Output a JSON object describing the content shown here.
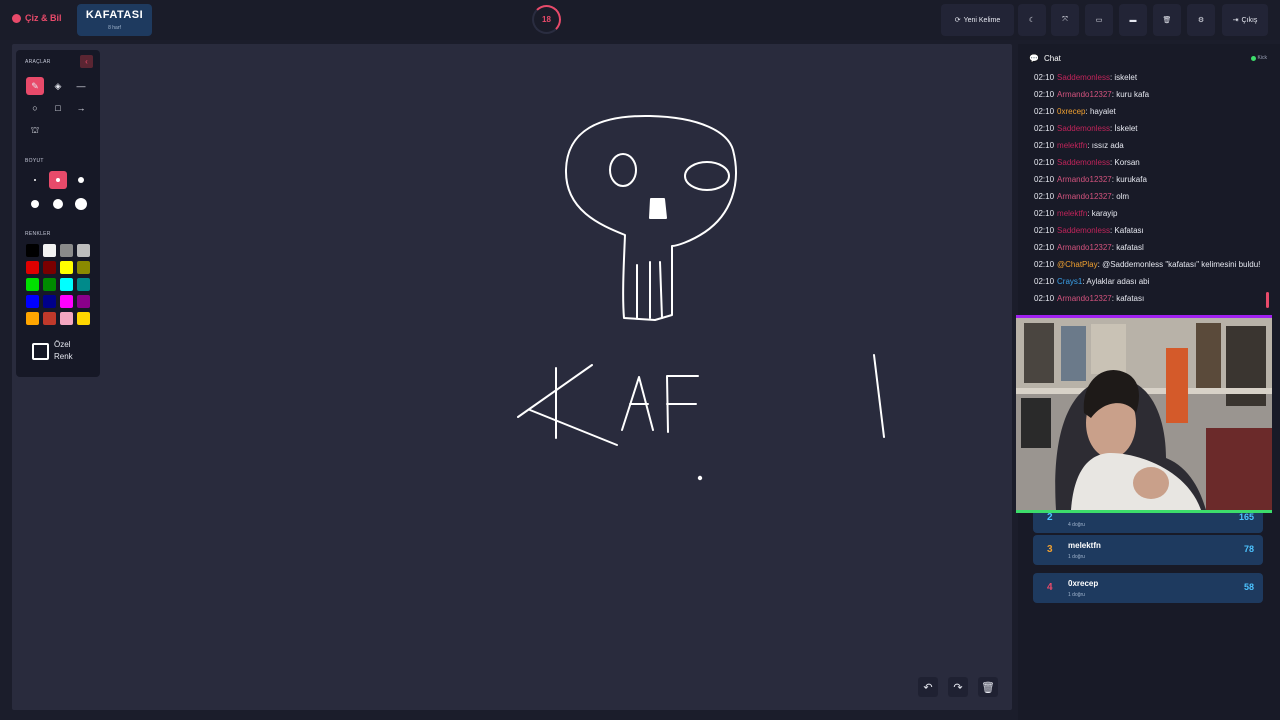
{
  "brand": {
    "name": "Çiz & Bil"
  },
  "word": {
    "text": "KAFATASI",
    "hint": "8 harf"
  },
  "timer": {
    "value": "18"
  },
  "toolbar": {
    "new_word": "Yeni Kelime",
    "exit": "Çıkış"
  },
  "tools": {
    "section_tools": "ARAÇLAR",
    "section_size": "BOYUT",
    "section_colors": "RENKLER",
    "custom_color": "Özel Renk",
    "selected_tool": "pencil",
    "selected_size_index": 1,
    "palette": [
      "#000000",
      "#f2f2f2",
      "#8a8a8a",
      "#bdbdbd",
      "#e00000",
      "#7a0000",
      "#ffff00",
      "#8a8a00",
      "#00e000",
      "#008a00",
      "#00ffff",
      "#008a8a",
      "#0000ff",
      "#00008a",
      "#ff00ff",
      "#8a008a",
      "#ffa500",
      "#c0392b",
      "#f4a6c0",
      "#ffd700"
    ]
  },
  "chat": {
    "title": "Chat",
    "source": "Kick",
    "messages": [
      {
        "time": "02:10",
        "user": "Saddemonless",
        "user_color": "#c0245a",
        "text": "iskelet"
      },
      {
        "time": "02:10",
        "user": "Armando12327",
        "user_color": "#d4537e",
        "text": "kuru kafa"
      },
      {
        "time": "02:10",
        "user": "0xrecep",
        "user_color": "#f0a030",
        "text": "hayalet"
      },
      {
        "time": "02:10",
        "user": "Saddemonless",
        "user_color": "#c0245a",
        "text": "İskelet"
      },
      {
        "time": "02:10",
        "user": "melektfn",
        "user_color": "#c0245a",
        "text": "ıssız ada"
      },
      {
        "time": "02:10",
        "user": "Saddemonless",
        "user_color": "#c0245a",
        "text": "Korsan"
      },
      {
        "time": "02:10",
        "user": "Armando12327",
        "user_color": "#d4537e",
        "text": "kurukafa"
      },
      {
        "time": "02:10",
        "user": "Armando12327",
        "user_color": "#d4537e",
        "text": "olm"
      },
      {
        "time": "02:10",
        "user": "melektfn",
        "user_color": "#c0245a",
        "text": "karayip"
      },
      {
        "time": "02:10",
        "user": "Saddemonless",
        "user_color": "#c0245a",
        "text": "Kafatası"
      },
      {
        "time": "02:10",
        "user": "Armando12327",
        "user_color": "#d4537e",
        "text": "kafatasl"
      },
      {
        "time": "02:10",
        "user": "@ChatPlay",
        "user_color": "#f0a030",
        "text": "@Saddemonless \"kafatası\" kelimesini buldu!"
      },
      {
        "time": "02:10",
        "user": "Crays1",
        "user_color": "#3aa0e8",
        "text": "Aylaklar adası abi"
      },
      {
        "time": "02:10",
        "user": "Armando12327",
        "user_color": "#d4537e",
        "text": "kafatası"
      }
    ]
  },
  "scoreboard": [
    {
      "rank": "2",
      "name": "",
      "sub": "4 doğru",
      "points": "165",
      "rank_color": "#4cc3ff"
    },
    {
      "rank": "3",
      "name": "melektfn",
      "sub": "1 doğru",
      "points": "78",
      "rank_color": "#f0a030"
    },
    {
      "rank": "4",
      "name": "0xrecep",
      "sub": "1 doğru",
      "points": "58",
      "rank_color": "#e84a6a"
    }
  ],
  "colors": {
    "accent": "#e84a6a",
    "panel_blue": "#1e3a5f",
    "canvas_bg": "#292b3d"
  }
}
